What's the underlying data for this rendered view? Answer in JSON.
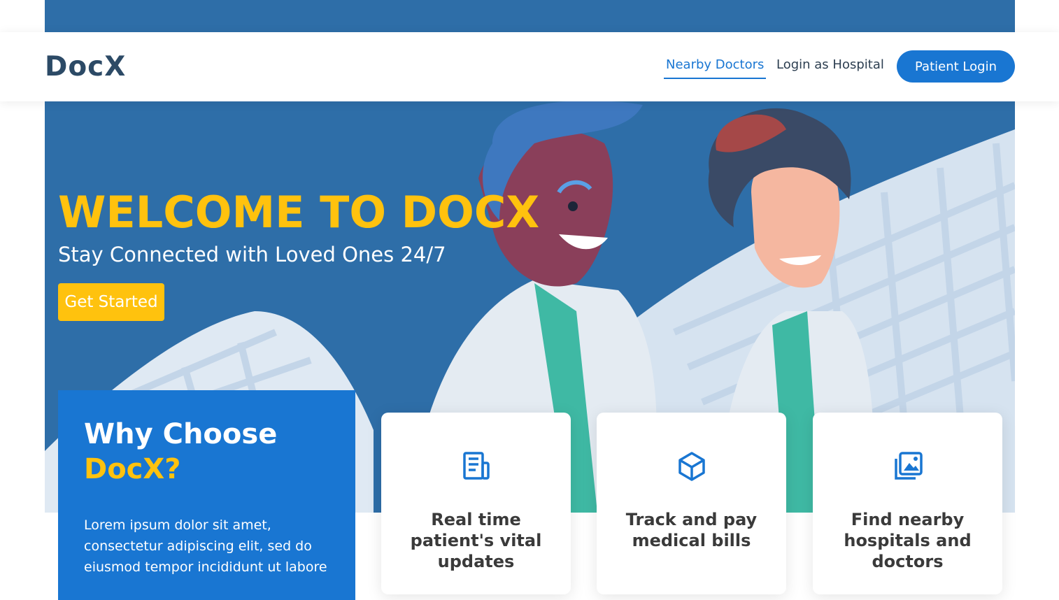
{
  "brand": {
    "logo_text": "DocX",
    "accent_color": "#1976d2",
    "highlight_color": "#ffc20e"
  },
  "nav": {
    "links": [
      {
        "label": "Nearby Doctors",
        "active": true
      },
      {
        "label": "Login as Hospital",
        "active": false
      }
    ],
    "cta_label": "Patient Login"
  },
  "hero": {
    "title": "WELCOME TO DOCX",
    "subtitle": "Stay Connected with Loved Ones 24/7",
    "button_label": "Get Started"
  },
  "why": {
    "title_line1": "Why Choose",
    "title_line2": "DocX?",
    "text": "Lorem ipsum dolor sit amet, consectetur adipiscing elit, sed do eiusmod tempor incididunt ut labore"
  },
  "features": [
    {
      "icon": "news-icon",
      "label": "Real time patient's vital updates"
    },
    {
      "icon": "cube-icon",
      "label": "Track and pay medical bills"
    },
    {
      "icon": "images-icon",
      "label": "Find nearby hospitals and doctors"
    }
  ]
}
